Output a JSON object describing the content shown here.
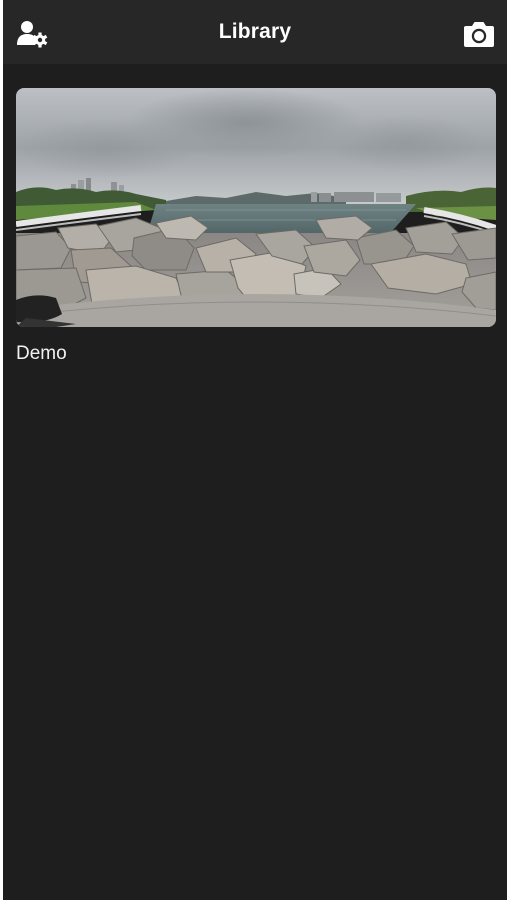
{
  "header": {
    "title": "Library",
    "left_icon": "user-settings-icon",
    "right_icon": "camera-icon"
  },
  "library": {
    "items": [
      {
        "title": "Demo",
        "thumbnail": "panorama-waterfront-rocks-image"
      }
    ]
  },
  "colors": {
    "background": "#1e1e1e",
    "navbar": "#272727",
    "text": "#ffffff"
  }
}
